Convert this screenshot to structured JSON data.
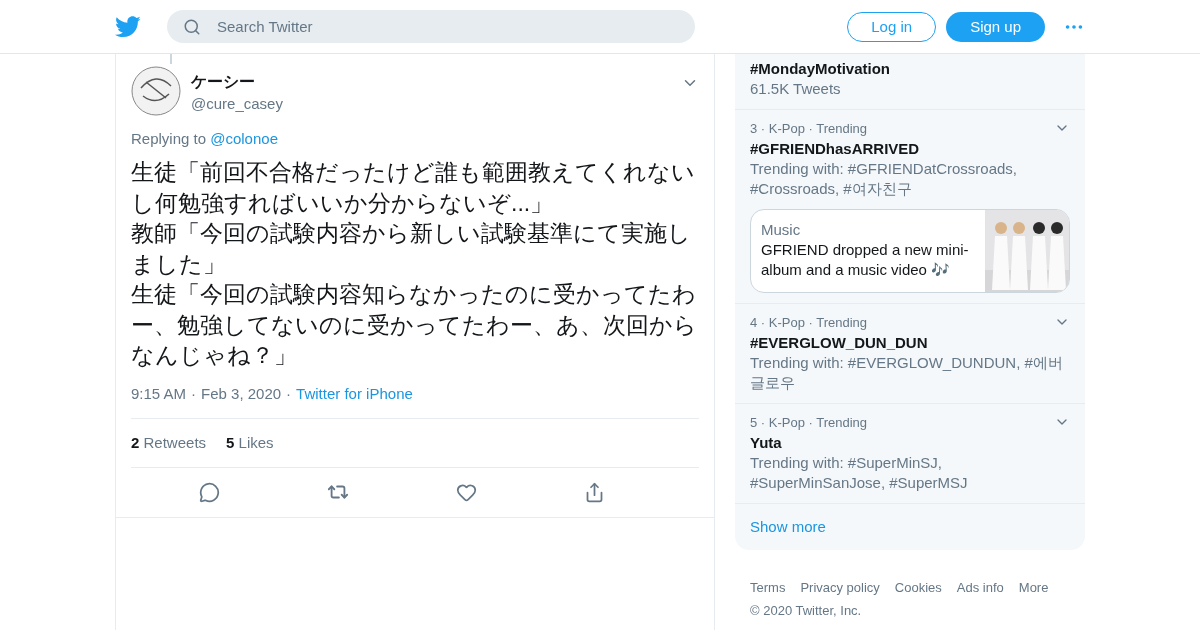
{
  "header": {
    "search": {
      "placeholder": "Search Twitter"
    },
    "login": "Log in",
    "signup": "Sign up"
  },
  "tweet": {
    "name": "ケーシー",
    "handle": "@cure_casey",
    "replying_label": "Replying to",
    "replying_to": "@colonoe",
    "text": [
      "生徒「前回不合格だったけど誰も範囲教えてくれないし何勉強すればいいか分からないぞ...」",
      "教師「今回の試験内容から新しい試験基準にて実施しました」",
      "生徒「今回の試験内容知らなかったのに受かってたわー、勉強してないのに受かってたわー、あ、次回からなんじゃね？」"
    ],
    "time": "9:15 AM",
    "separator_1": "·",
    "date": "Feb 3, 2020",
    "separator_2": "·",
    "source": "Twitter for iPhone",
    "stats": [
      {
        "count": "2",
        "label": "Retweets"
      },
      {
        "count": "5",
        "label": "Likes"
      }
    ]
  },
  "trends": [
    {
      "title": "#MondayMotivation",
      "subtitle": "61.5K Tweets"
    },
    {
      "meta": "3 · K-Pop · Trending",
      "title": "#GFRIENDhasARRIVED",
      "subtitle": "Trending with: #GFRIENDatCrossroads, #Crossroads, #여자친구",
      "card": {
        "category": "Music",
        "text": "GFRIEND dropped a new mini-album and a music video 🎶"
      }
    },
    {
      "meta": "4 · K-Pop · Trending",
      "title": "#EVERGLOW_DUN_DUN",
      "subtitle": "Trending with: #EVERGLOW_DUNDUN, #에버글로우"
    },
    {
      "meta": "5 · K-Pop · Trending",
      "title": "Yuta",
      "subtitle": "Trending with: #SuperMinSJ, #SuperMinSanJose, #SuperMSJ"
    }
  ],
  "show_more": "Show more",
  "footer": [
    "Terms",
    "Privacy policy",
    "Cookies",
    "Ads info",
    "More",
    "© 2020 Twitter, Inc."
  ]
}
